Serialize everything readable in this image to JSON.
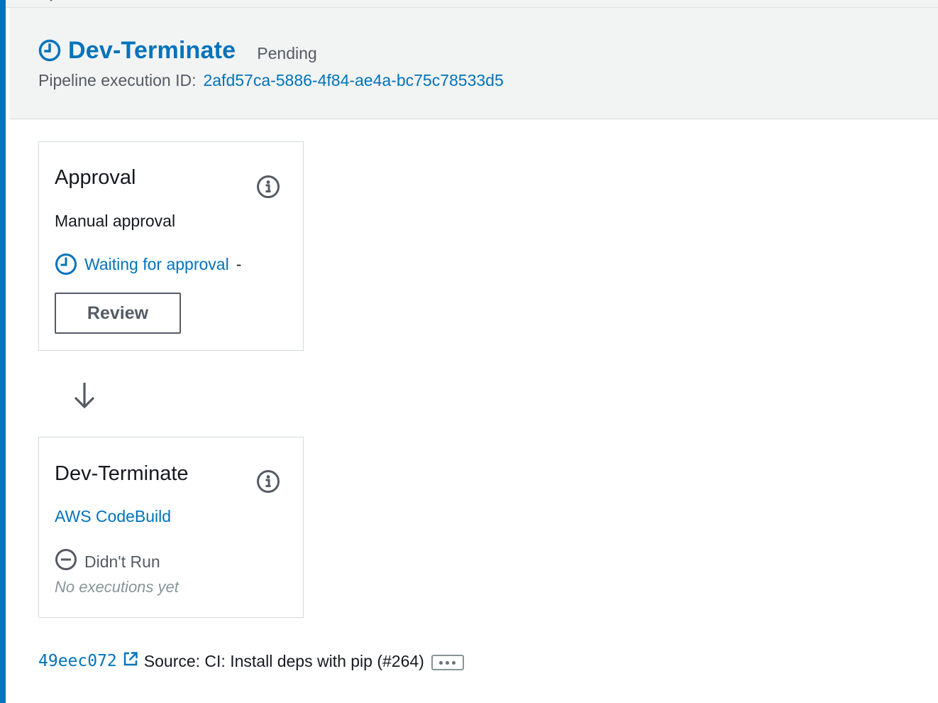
{
  "header": {
    "title": "Dev-Terminate",
    "status": "Pending",
    "execution_label": "Pipeline execution ID:",
    "execution_id": "2afd57ca-5886-4f84-ae4a-bc75c78533d5",
    "status_icon": "clock-icon"
  },
  "stages": [
    {
      "title": "Approval",
      "action": "Manual approval",
      "status_icon": "clock-icon",
      "status": "Waiting for approval",
      "status_suffix": "-",
      "button_label": "Review",
      "info_icon": "info-icon"
    },
    {
      "title": "Dev-Terminate",
      "action": "AWS CodeBuild",
      "status_icon": "minus-circle-icon",
      "status": "Didn't Run",
      "note": "No executions yet",
      "info_icon": "info-icon"
    }
  ],
  "transition_icon": "arrow-down-icon",
  "footer": {
    "commit_id": "49eec072",
    "external_icon": "external-link-icon",
    "source_text": "Source: CI: Install deps with pip (#264)",
    "more_icon": "ellipsis-icon"
  },
  "colors": {
    "accent": "#0073bb",
    "header_bg": "#f2f3f3",
    "border": "#d5dbdb",
    "muted_text": "#545b64"
  }
}
